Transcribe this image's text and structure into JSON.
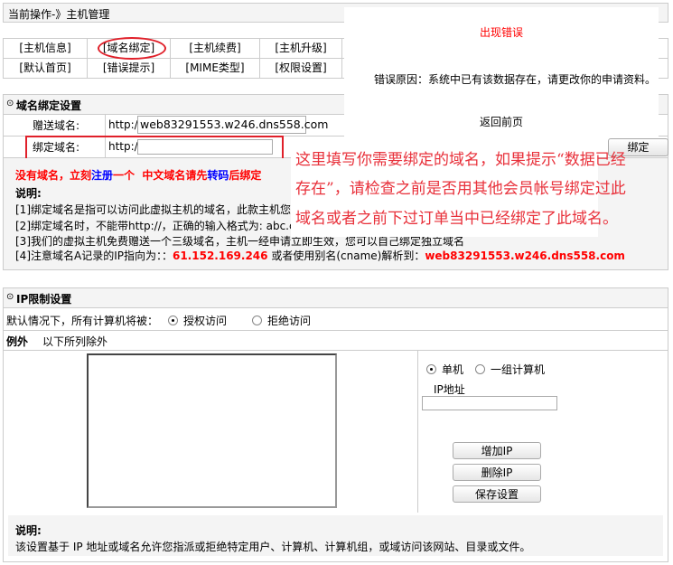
{
  "header": {
    "breadcrumb": "当前操作-》主机管理"
  },
  "nav": {
    "items": [
      {
        "label": "[主机信息]"
      },
      {
        "label": "[域名绑定]",
        "active": true
      },
      {
        "label": "[主机续费]"
      },
      {
        "label": "[主机升级]"
      },
      {
        "label": "[默认首页]"
      },
      {
        "label": "[错误提示]"
      },
      {
        "label": "[MIME类型]"
      },
      {
        "label": "[权限设置]"
      }
    ]
  },
  "domain": {
    "title": "域名绑定设置",
    "gift_label": "赠送域名:",
    "gift_prefix": "http://",
    "gift_value": "web83291553.w246.dns558.com",
    "bind_label": "绑定域名:",
    "bind_prefix": "http://",
    "bind_value": "",
    "bind_button": "绑定",
    "promo": {
      "part1": "没有域名，立刻",
      "link1": "注册",
      "part2": "一个  中文域名请先",
      "link2": "转码",
      "part3": "后绑定"
    },
    "note_title": "说明:",
    "notes": [
      "[1]绑定域名是指可以访问此虚拟主机的域名，此款主机您",
      "[2]绑定域名时，不能带http://，正确的输入格式为: abc.cc",
      "[3]我们的虚拟主机免费赠送一个三级域名，主机一经申请立即生效，您可以自己绑定独立域名"
    ],
    "note4": {
      "prefix": "[4]注意域名A记录的IP指向为：：",
      "ip": "61.152.169.246",
      "mid": " 或者使用别名(cname)解析到：",
      "cname": "web83291553.w246.dns558.com"
    }
  },
  "error_popup": {
    "title": "出现错误",
    "reason": "错误原因：系统中已有该数据存在，请更改你的申请资料。",
    "back": "返回前页"
  },
  "annotation": {
    "lines": [
      "这里填写你需要绑定的域名，如果提示“数据已经",
      "存在”，请检查之前是否用其他会员帐号绑定过此",
      "域名或者之前下过订单当中已经绑定了此域名。"
    ]
  },
  "ip": {
    "title": "IP限制设置",
    "default_label": "默认情况下，所有计算机将被：",
    "allow": "授权访问",
    "deny": "拒绝访问",
    "default_selected": "allow",
    "exception_label": "例外",
    "exception_text": "以下所列除外",
    "single": "单机",
    "group": "一组计算机",
    "mode_selected": "single",
    "ip_label": "IP地址",
    "ip_value": "",
    "add_button": "增加IP",
    "delete_button": "删除IP",
    "save_button": "保存设置",
    "note_title": "说明:",
    "note": "该设置基于 IP 地址或域名允许您指派或拒绝特定用户、计算机、计算机组，或域访问该网站、目录或文件。"
  },
  "colors": {
    "accent_red": "#ff0000",
    "link_blue": "#0000ff",
    "panel_bg": "#f4f4f4",
    "border": "#cccccc"
  }
}
